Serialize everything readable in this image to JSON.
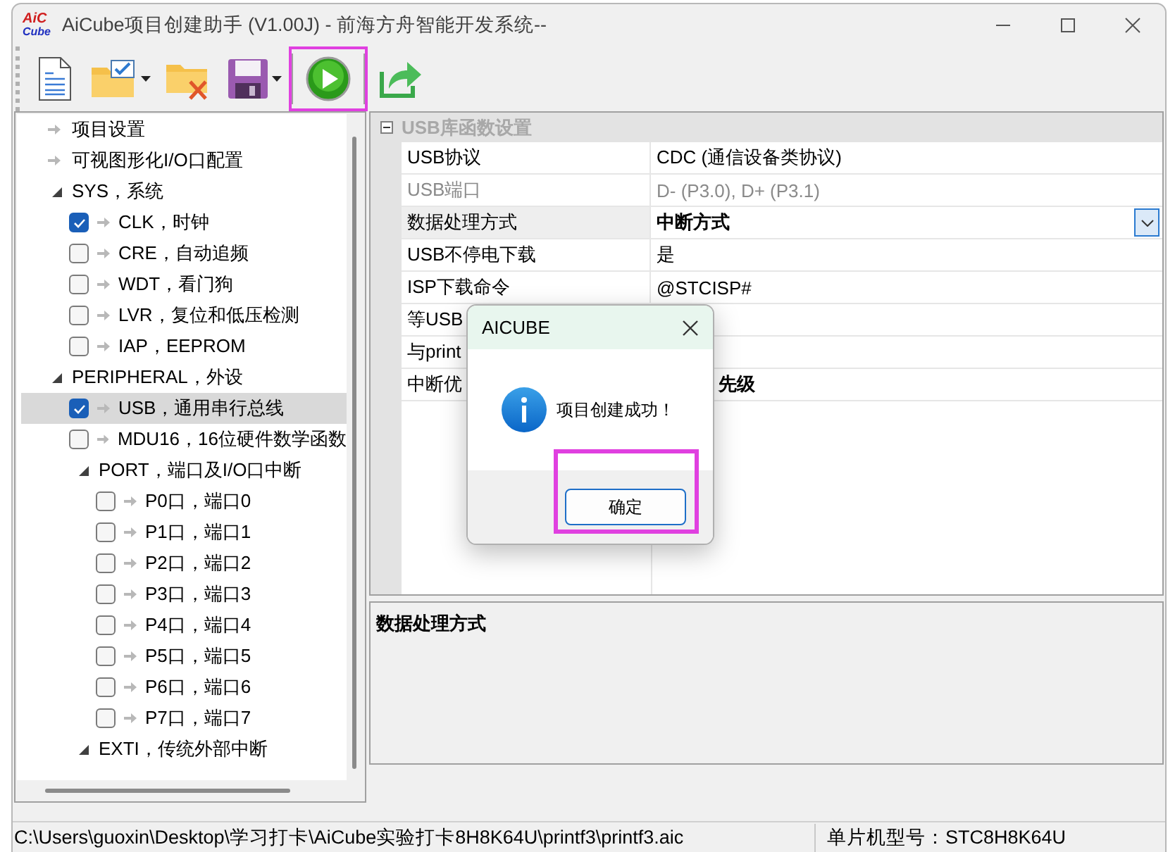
{
  "window": {
    "logo_top": "AiC",
    "logo_bottom": "Cube",
    "title": "AiCube项目创建助手 (V1.00J) - 前海方舟智能开发系统--"
  },
  "toolbar": [
    {
      "kind": "new",
      "highlighted": false
    },
    {
      "kind": "open",
      "highlighted": false
    },
    {
      "kind": "dropdown"
    },
    {
      "kind": "close",
      "highlighted": false
    },
    {
      "kind": "save",
      "highlighted": false
    },
    {
      "kind": "dropdown"
    },
    {
      "kind": "separator"
    },
    {
      "kind": "run",
      "highlighted": true
    },
    {
      "kind": "separator"
    },
    {
      "kind": "export",
      "highlighted": false
    }
  ],
  "tree": [
    {
      "label": "项目设置",
      "kind": "leaf",
      "selected": false
    },
    {
      "label": "可视图形化I/O口配置",
      "kind": "leaf",
      "selected": false
    },
    {
      "label": "SYS，系统",
      "kind": "group",
      "expanded": true,
      "selected": false,
      "children": [
        {
          "label": "CLK，时钟",
          "kind": "check",
          "checked": true,
          "selected": false
        },
        {
          "label": "CRE，自动追频",
          "kind": "check",
          "checked": false,
          "selected": false
        },
        {
          "label": "WDT，看门狗",
          "kind": "check",
          "checked": false,
          "selected": false
        },
        {
          "label": "LVR，复位和低压检测",
          "kind": "check",
          "checked": false,
          "selected": false
        },
        {
          "label": "IAP，EEPROM",
          "kind": "check",
          "checked": false,
          "selected": false
        }
      ]
    },
    {
      "label": "PERIPHERAL，外设",
      "kind": "group",
      "expanded": true,
      "selected": false,
      "children": [
        {
          "label": "USB，通用串行总线",
          "kind": "check",
          "checked": true,
          "selected": true
        },
        {
          "label": "MDU16，16位硬件数学函数",
          "kind": "check",
          "checked": false,
          "selected": false
        },
        {
          "label": "PORT，端口及I/O口中断",
          "kind": "group",
          "expanded": true,
          "selected": false,
          "children": [
            {
              "label": "P0口，端口0",
              "kind": "check",
              "checked": false,
              "selected": false
            },
            {
              "label": "P1口，端口1",
              "kind": "check",
              "checked": false,
              "selected": false
            },
            {
              "label": "P2口，端口2",
              "kind": "check",
              "checked": false,
              "selected": false
            },
            {
              "label": "P3口，端口3",
              "kind": "check",
              "checked": false,
              "selected": false
            },
            {
              "label": "P4口，端口4",
              "kind": "check",
              "checked": false,
              "selected": false
            },
            {
              "label": "P5口，端口5",
              "kind": "check",
              "checked": false,
              "selected": false
            },
            {
              "label": "P6口，端口6",
              "kind": "check",
              "checked": false,
              "selected": false
            },
            {
              "label": "P7口，端口7",
              "kind": "check",
              "checked": false,
              "selected": false
            }
          ]
        },
        {
          "label": "EXTI，传统外部中断",
          "kind": "group",
          "expanded": true,
          "selected": false
        }
      ]
    }
  ],
  "property_grid": {
    "category": {
      "label": "USB库函数设置",
      "expanded": true
    },
    "rows": [
      {
        "name": "USB协议",
        "value": "CDC (通信设备类协议)",
        "disabled": false,
        "modified": false,
        "selected": false,
        "covered": false
      },
      {
        "name": "USB端口",
        "value": "D- (P3.0), D+ (P3.1)",
        "disabled": true,
        "modified": false,
        "selected": false,
        "covered": false
      },
      {
        "name": "数据处理方式",
        "value": "中断方式",
        "disabled": false,
        "modified": true,
        "selected": true,
        "covered": false
      },
      {
        "name": "USB不停电下载",
        "value": "是",
        "disabled": false,
        "modified": false,
        "selected": false,
        "covered": false
      },
      {
        "name": "ISP下载命令",
        "value": "@STCISP#",
        "disabled": false,
        "modified": false,
        "selected": false,
        "covered": false
      },
      {
        "name": "等USB",
        "disabled": false,
        "selected": false,
        "covered": true
      },
      {
        "name": "与print",
        "disabled": false,
        "selected": false,
        "covered": true
      },
      {
        "name": "中断优",
        "value": "先级",
        "disabled": false,
        "modified": true,
        "selected": false,
        "covered": true
      }
    ],
    "description": {
      "title": "数据处理方式"
    }
  },
  "dialog": {
    "title": "AICUBE",
    "message": "项目创建成功！",
    "button": "确定",
    "button_highlighted": true
  },
  "status_bar": {
    "path": "C:\\Users\\guoxin\\Desktop\\学习打卡\\AiCube实验打卡8H8K64U\\printf3\\printf3.aic",
    "model": "单片机型号：STC8H8K64U"
  }
}
